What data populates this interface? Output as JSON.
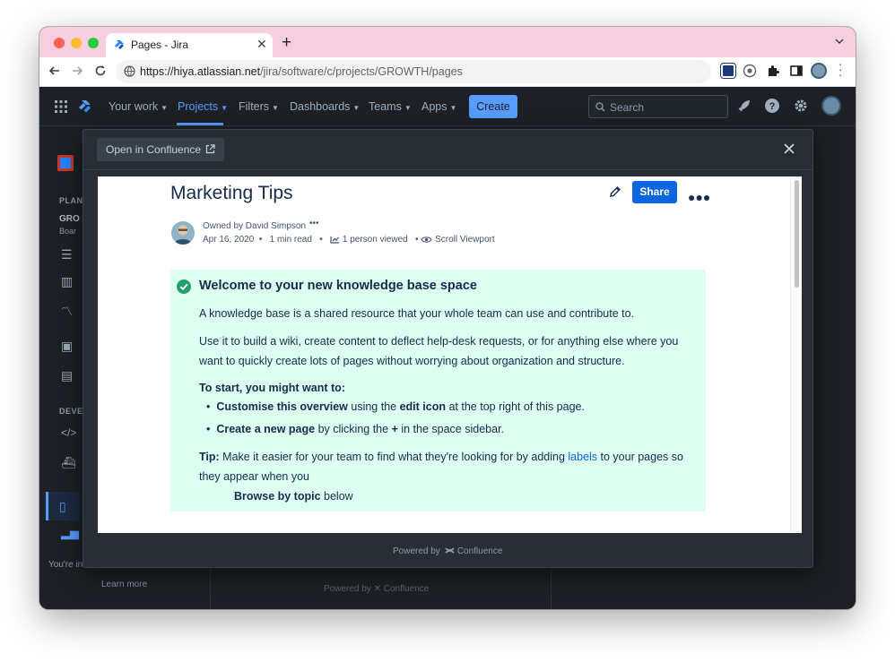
{
  "browser": {
    "tab_title": "Pages - Jira",
    "url_host": "https://hiya.atlassian.net",
    "url_path": "/jira/software/c/projects/GROWTH/pages"
  },
  "nav": {
    "items": [
      "Your work",
      "Projects",
      "Filters",
      "Dashboards",
      "Teams",
      "Apps"
    ],
    "create_label": "Create",
    "search_placeholder": "Search"
  },
  "background": {
    "sidebar_planning": "PLAN",
    "project_abbrev": "GRO",
    "board_abbrev": "Boar",
    "sidebar_dev": "DEVE",
    "youre": "You're in",
    "learn_more": "Learn more",
    "powered_by": "Powered by",
    "confluence": "Confluence"
  },
  "modal": {
    "open_label": "Open in Confluence",
    "powered_by": "Powered by",
    "confluence": "Confluence"
  },
  "page": {
    "title": "Marketing Tips",
    "share_label": "Share",
    "owned_by": "Owned by David Simpson",
    "date": "Apr 16, 2020",
    "read_time": "1 min read",
    "views": "1 person viewed",
    "viewport": "Scroll Viewport"
  },
  "panel": {
    "title": "Welcome to your new knowledge base space",
    "intro": "A knowledge base is a shared resource that your whole team can use and contribute to.",
    "use_line1": "Use it to build a wiki, create content to deflect help-desk requests, or for anything else where you",
    "use_line2": "want to quickly create lots of pages without worrying about organization and structure.",
    "start_heading": "To start, you might want to:",
    "b1_bold": "Customise this overview",
    "b1_mid": " using the ",
    "b1_bold2": "edit icon",
    "b1_end": " at the top right of this page.",
    "b2_bold": "Create a new page",
    "b2_mid": " by clicking the ",
    "b2_bold2": "+",
    "b2_end": " in the space sidebar.",
    "tip_label": "Tip:",
    "tip_text": " Make it easier for your team to find what they're looking for by adding ",
    "tip_link": "labels",
    "tip_end": " to your pages so",
    "tip_line2": "they appear when you",
    "browse_bold": "Browse by topic",
    "browse_end": " below"
  },
  "colors": {
    "tab_strip": "#f7cde0",
    "jira_bg": "#1d2125",
    "accent": "#579dff",
    "share_button": "#0c66e4",
    "panel_bg": "#dcfff1",
    "check_green": "#22a06b"
  }
}
